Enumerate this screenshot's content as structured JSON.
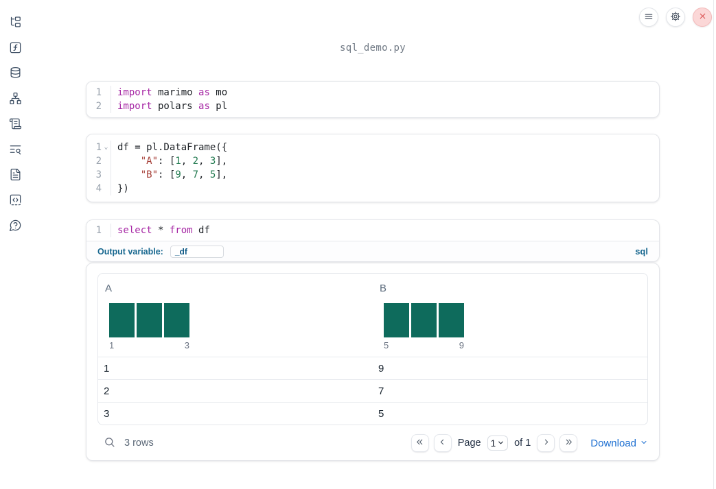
{
  "colors": {
    "kw": "#a626a4",
    "str": "#a63f38",
    "num": "#227a50",
    "bar_teal": "#0e6b5c",
    "accent_blue": "#17678f",
    "link_blue": "#1d6fd1"
  },
  "titlebar": {
    "filename": "sql_demo.py"
  },
  "sidebar": {
    "items": [
      {
        "icon": "folder-tree-icon"
      },
      {
        "icon": "function-square-icon"
      },
      {
        "icon": "database-icon"
      },
      {
        "icon": "network-icon"
      },
      {
        "icon": "scroll-icon"
      },
      {
        "icon": "text-search-icon"
      },
      {
        "icon": "file-text-icon"
      },
      {
        "icon": "code-square-icon"
      },
      {
        "icon": "help-circle-icon"
      }
    ]
  },
  "cells": [
    {
      "kind": "python",
      "lines": [
        {
          "num": "1",
          "tokens": [
            {
              "t": "import",
              "c": "kw"
            },
            {
              "t": " marimo ",
              "c": "pl"
            },
            {
              "t": "as",
              "c": "kw"
            },
            {
              "t": " mo",
              "c": "pl"
            }
          ]
        },
        {
          "num": "2",
          "tokens": [
            {
              "t": "import",
              "c": "kw"
            },
            {
              "t": " polars ",
              "c": "pl"
            },
            {
              "t": "as",
              "c": "kw"
            },
            {
              "t": " pl",
              "c": "pl"
            }
          ]
        }
      ]
    },
    {
      "kind": "python",
      "lines": [
        {
          "num": "1",
          "fold": true,
          "tokens": [
            {
              "t": "df = pl.DataFrame({",
              "c": "pl"
            }
          ]
        },
        {
          "num": "2",
          "tokens": [
            {
              "t": "    ",
              "c": "pl"
            },
            {
              "t": "\"A\"",
              "c": "str"
            },
            {
              "t": ": [",
              "c": "pl"
            },
            {
              "t": "1",
              "c": "num"
            },
            {
              "t": ", ",
              "c": "pl"
            },
            {
              "t": "2",
              "c": "num"
            },
            {
              "t": ", ",
              "c": "pl"
            },
            {
              "t": "3",
              "c": "num"
            },
            {
              "t": "],",
              "c": "pl"
            }
          ]
        },
        {
          "num": "3",
          "tokens": [
            {
              "t": "    ",
              "c": "pl"
            },
            {
              "t": "\"B\"",
              "c": "str"
            },
            {
              "t": ": [",
              "c": "pl"
            },
            {
              "t": "9",
              "c": "num"
            },
            {
              "t": ", ",
              "c": "pl"
            },
            {
              "t": "7",
              "c": "num"
            },
            {
              "t": ", ",
              "c": "pl"
            },
            {
              "t": "5",
              "c": "num"
            },
            {
              "t": "],",
              "c": "pl"
            }
          ]
        },
        {
          "num": "4",
          "tokens": [
            {
              "t": "})",
              "c": "pl"
            }
          ]
        }
      ]
    },
    {
      "kind": "sql",
      "lines": [
        {
          "num": "1",
          "tokens": [
            {
              "t": "select",
              "c": "kw"
            },
            {
              "t": " * ",
              "c": "pl"
            },
            {
              "t": "from",
              "c": "kw"
            },
            {
              "t": " df",
              "c": "pl"
            }
          ]
        }
      ],
      "footer": {
        "label": "Output variable:",
        "variable": "_df",
        "language": "sql"
      }
    }
  ],
  "output": {
    "table": {
      "columns": [
        {
          "header": "A",
          "hist": {
            "bars": [
              1,
              1,
              1
            ],
            "min_label": "1",
            "max_label": "3"
          }
        },
        {
          "header": "B",
          "hist": {
            "bars": [
              1,
              1,
              1
            ],
            "min_label": "5",
            "max_label": "9"
          }
        }
      ],
      "rows": [
        [
          "1",
          "9"
        ],
        [
          "2",
          "7"
        ],
        [
          "3",
          "5"
        ]
      ]
    },
    "footer": {
      "row_count": "3 rows",
      "page_label": "Page",
      "page_value": "1",
      "of_label": "of 1",
      "download_label": "Download"
    }
  }
}
